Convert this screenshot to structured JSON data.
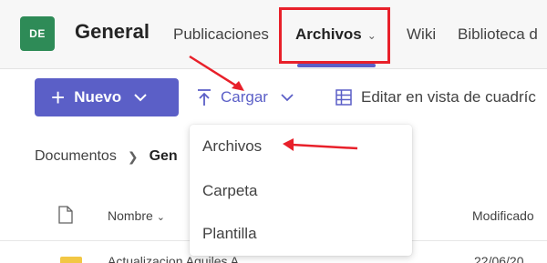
{
  "header": {
    "team_initials": "DE",
    "team_name": "General",
    "tabs": [
      {
        "label": "Publicaciones"
      },
      {
        "label": "Archivos"
      },
      {
        "label": "Wiki"
      },
      {
        "label": "Biblioteca d"
      }
    ]
  },
  "toolbar": {
    "new_label": "Nuevo",
    "upload_label": "Cargar",
    "grid_label": "Editar en vista de cuadríc"
  },
  "upload_menu": {
    "items": [
      {
        "label": "Archivos"
      },
      {
        "label": "Carpeta"
      },
      {
        "label": "Plantilla"
      }
    ]
  },
  "breadcrumb": {
    "root": "Documentos",
    "current": "Gen"
  },
  "table": {
    "columns": {
      "name": "Nombre",
      "modified": "Modificado"
    },
    "rows": [
      {
        "name": "Actualizacion Aquiles A...",
        "modified": "22/06/20"
      }
    ]
  },
  "colors": {
    "accent": "#5b5fc7",
    "team_avatar": "#2e8b57",
    "annotation": "#e8202a"
  },
  "icons": [
    "plus-icon",
    "chevron-down-icon",
    "upload-icon",
    "grid-icon",
    "file-icon",
    "folder-icon",
    "chevron-right-icon"
  ]
}
